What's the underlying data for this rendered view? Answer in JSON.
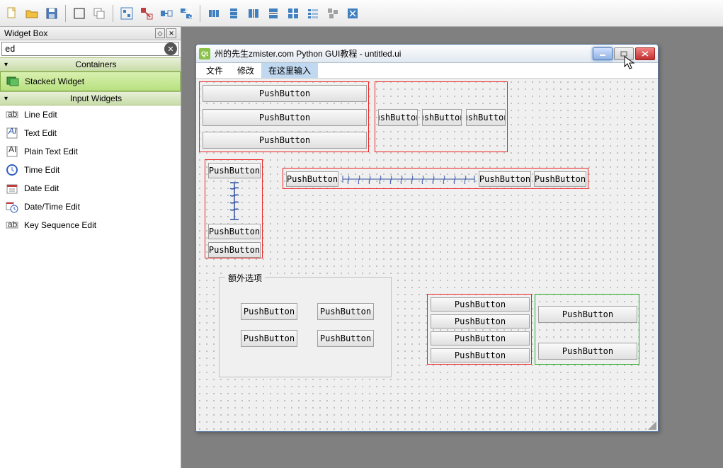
{
  "widgetbox": {
    "title": "Widget Box",
    "search_value": "ed",
    "categories": [
      {
        "label": "Containers",
        "open": true,
        "items": [
          {
            "name": "Stacked Widget",
            "icon": "stacked",
            "selected": true
          }
        ]
      },
      {
        "label": "Input Widgets",
        "open": true,
        "items": [
          {
            "name": "Line Edit",
            "icon": "lineedit"
          },
          {
            "name": "Text Edit",
            "icon": "textedit"
          },
          {
            "name": "Plain Text Edit",
            "icon": "plaintext"
          },
          {
            "name": "Time Edit",
            "icon": "time"
          },
          {
            "name": "Date Edit",
            "icon": "date"
          },
          {
            "name": "Date/Time Edit",
            "icon": "datetime"
          },
          {
            "name": "Key Sequence Edit",
            "icon": "keyseq"
          }
        ]
      }
    ]
  },
  "window": {
    "title": "州的先生zmister.com Python GUI教程 - untitled.ui",
    "menus": [
      "文件",
      "修改",
      "在这里输入"
    ],
    "buttons": {
      "push": "PushButton",
      "push_cut": "ushButton"
    },
    "groupbox_title": "额外选项"
  }
}
